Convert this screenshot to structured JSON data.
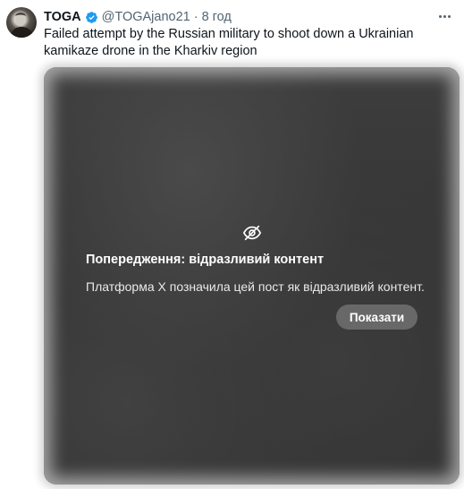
{
  "tweet": {
    "author_name": "TOGA",
    "author_handle": "@TOGAjano21",
    "separator": "·",
    "time": "8 год",
    "text": "Failed attempt by the Russian military to shoot down a Ukrainian kamikaze drone in the Kharkiv region"
  },
  "media": {
    "warning_title": "Попередження: відразливий контент",
    "warning_description": "Платформа X позначила цей пост як відразливий контент.",
    "show_button_label": "Показати"
  },
  "colors": {
    "verified_badge": "#1d9bf0",
    "muted_text": "#536471",
    "primary_text": "#0f1419"
  },
  "icons": {
    "verified": "verified-badge-icon",
    "more": "more-options-icon",
    "sensitive": "eye-off-icon"
  }
}
